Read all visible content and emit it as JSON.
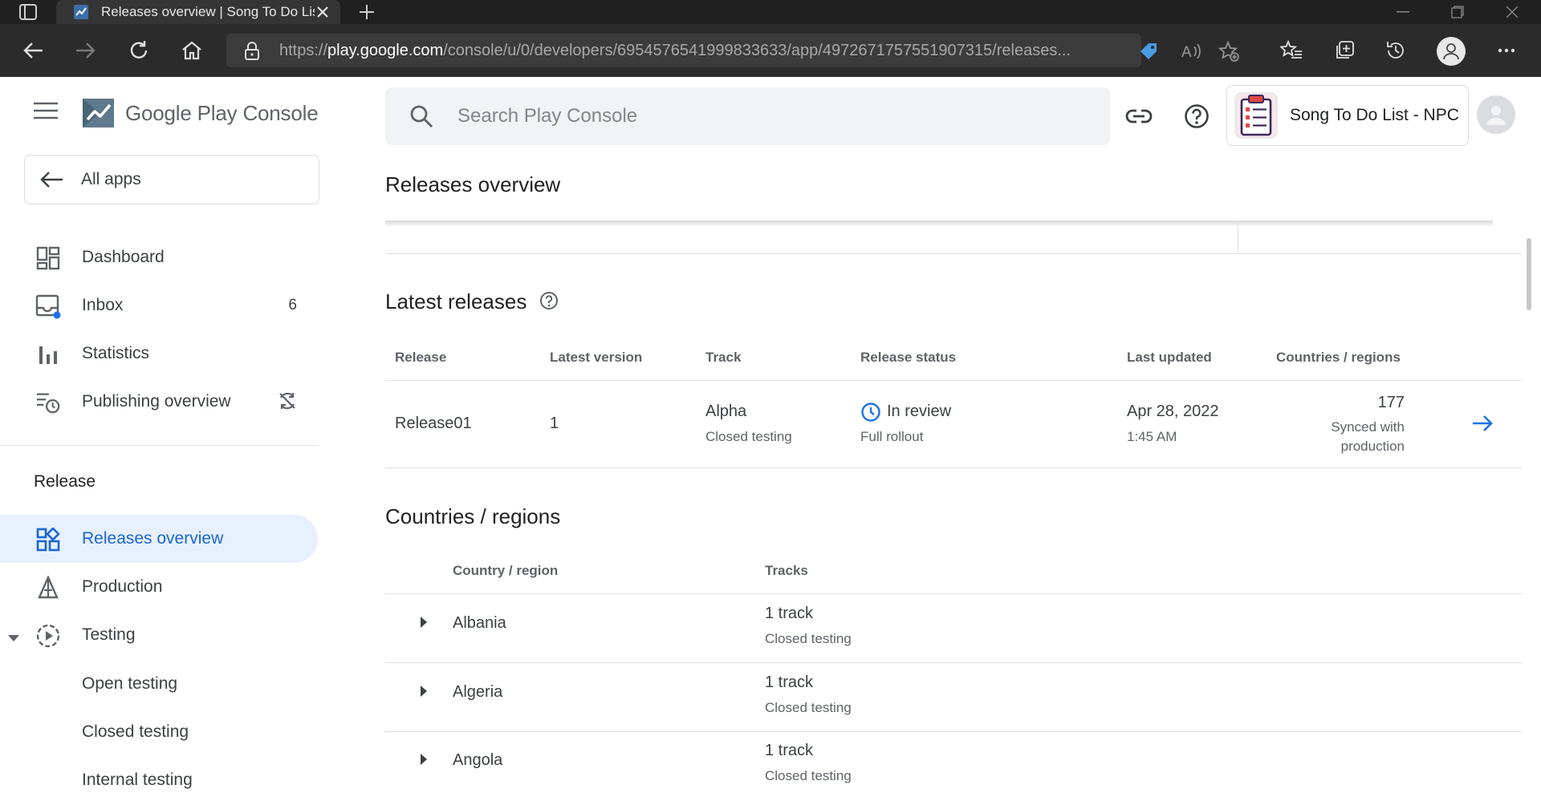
{
  "browser": {
    "tab_title": "Releases overview | Song To Do List",
    "url_prefix": "https://",
    "url_domain": "play.google.com",
    "url_path": "/console/u/0/developers/6954576541999833633/app/4972671757551907315/releases..."
  },
  "console": {
    "logo_text": "Google Play Console",
    "all_apps": "All apps",
    "search_placeholder": "Search Play Console",
    "app_name": "Song To Do List - NPC"
  },
  "sidebar": {
    "items": [
      {
        "label": "Dashboard"
      },
      {
        "label": "Inbox",
        "count": "6"
      },
      {
        "label": "Statistics"
      },
      {
        "label": "Publishing overview"
      }
    ],
    "release_section": "Release",
    "release_items": [
      {
        "label": "Releases overview"
      },
      {
        "label": "Production"
      },
      {
        "label": "Testing"
      }
    ],
    "testing_sub": [
      {
        "label": "Open testing"
      },
      {
        "label": "Closed testing"
      },
      {
        "label": "Internal testing"
      }
    ]
  },
  "main": {
    "page_title": "Releases overview",
    "latest_releases": {
      "title": "Latest releases",
      "columns": [
        "Release",
        "Latest version",
        "Track",
        "Release status",
        "Last updated",
        "Countries / regions"
      ],
      "row": {
        "release": "Release01",
        "version": "1",
        "track": "Alpha",
        "track_sub": "Closed testing",
        "status": "In review",
        "status_sub": "Full rollout",
        "updated_date": "Apr 28, 2022",
        "updated_time": "1:45 AM",
        "countries": "177",
        "countries_sub_1": "Synced with",
        "countries_sub_2": "production"
      }
    },
    "countries": {
      "title": "Countries / regions",
      "columns": [
        "Country / region",
        "Tracks"
      ],
      "rows": [
        {
          "country": "Albania",
          "tracks": "1 track",
          "tracks_sub": "Closed testing"
        },
        {
          "country": "Algeria",
          "tracks": "1 track",
          "tracks_sub": "Closed testing"
        },
        {
          "country": "Angola",
          "tracks": "1 track",
          "tracks_sub": "Closed testing"
        }
      ]
    }
  },
  "colors": {
    "accent": "#1a73e8",
    "active_bg": "#e8f0fe",
    "chrome_dark": "#202020"
  }
}
